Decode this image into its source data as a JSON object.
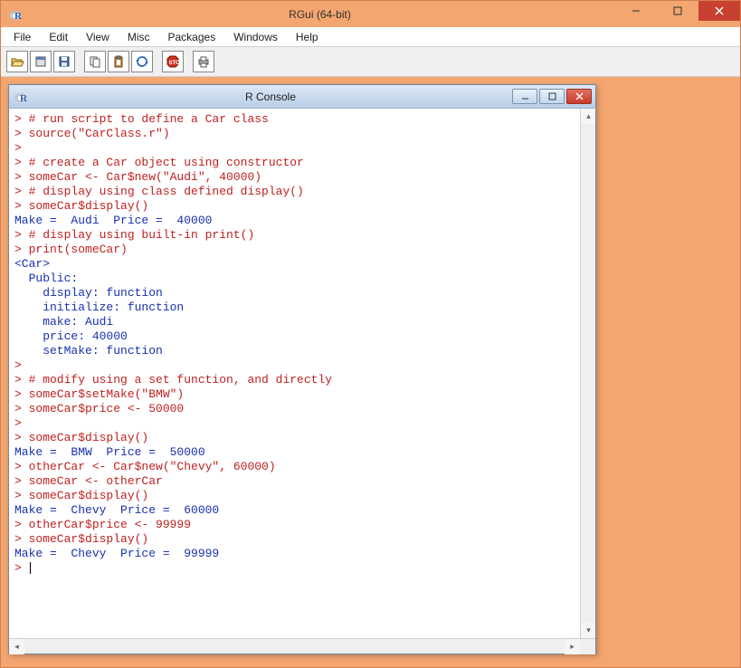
{
  "app": {
    "title": "RGui (64-bit)"
  },
  "menu": {
    "file": "File",
    "edit": "Edit",
    "view": "View",
    "misc": "Misc",
    "packages": "Packages",
    "windows": "Windows",
    "help": "Help"
  },
  "toolbar": {
    "open": "open-icon",
    "load": "load-workspace-icon",
    "save": "save-icon",
    "copy": "copy-icon",
    "paste": "paste-icon",
    "copypaste": "copy-paste-icon",
    "stop": "stop-icon",
    "print": "print-icon"
  },
  "console": {
    "title": "R Console",
    "lines": [
      {
        "t": "cmd",
        "s": "> # run script to define a Car class"
      },
      {
        "t": "cmd",
        "s": "> source(\"CarClass.r\")"
      },
      {
        "t": "cmd",
        "s": ">"
      },
      {
        "t": "cmd",
        "s": "> # create a Car object using constructor"
      },
      {
        "t": "cmd",
        "s": "> someCar <- Car$new(\"Audi\", 40000)"
      },
      {
        "t": "cmd",
        "s": "> # display using class defined display()"
      },
      {
        "t": "cmd",
        "s": "> someCar$display()"
      },
      {
        "t": "out",
        "s": "Make =  Audi  Price =  40000"
      },
      {
        "t": "cmd",
        "s": "> # display using built-in print()"
      },
      {
        "t": "cmd",
        "s": "> print(someCar)"
      },
      {
        "t": "out",
        "s": "<Car>"
      },
      {
        "t": "out",
        "s": "  Public:"
      },
      {
        "t": "out",
        "s": "    display: function"
      },
      {
        "t": "out",
        "s": "    initialize: function"
      },
      {
        "t": "out",
        "s": "    make: Audi"
      },
      {
        "t": "out",
        "s": "    price: 40000"
      },
      {
        "t": "out",
        "s": "    setMake: function"
      },
      {
        "t": "out",
        "s": ""
      },
      {
        "t": "cmd",
        "s": ">"
      },
      {
        "t": "cmd",
        "s": "> # modify using a set function, and directly"
      },
      {
        "t": "cmd",
        "s": "> someCar$setMake(\"BMW\")"
      },
      {
        "t": "cmd",
        "s": "> someCar$price <- 50000"
      },
      {
        "t": "cmd",
        "s": ">"
      },
      {
        "t": "cmd",
        "s": "> someCar$display()"
      },
      {
        "t": "out",
        "s": "Make =  BMW  Price =  50000"
      },
      {
        "t": "cmd",
        "s": "> otherCar <- Car$new(\"Chevy\", 60000)"
      },
      {
        "t": "cmd",
        "s": "> someCar <- otherCar"
      },
      {
        "t": "cmd",
        "s": "> someCar$display()"
      },
      {
        "t": "out",
        "s": "Make =  Chevy  Price =  60000"
      },
      {
        "t": "cmd",
        "s": "> otherCar$price <- 99999"
      },
      {
        "t": "cmd",
        "s": "> someCar$display()"
      },
      {
        "t": "out",
        "s": "Make =  Chevy  Price =  99999"
      }
    ],
    "prompt": "> "
  }
}
